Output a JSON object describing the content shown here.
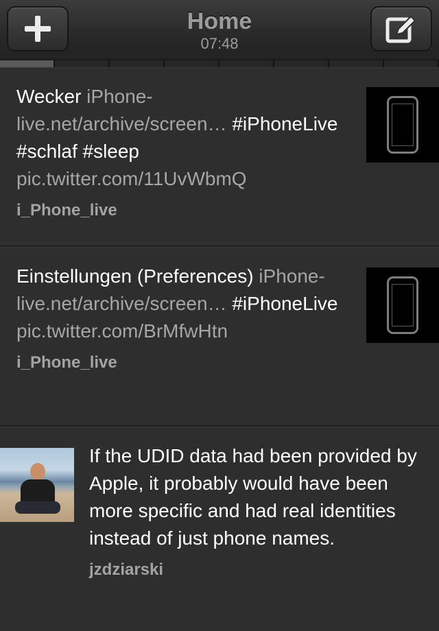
{
  "navbar": {
    "title": "Home",
    "time": "07:48",
    "left_button_icon": "plus-icon",
    "right_button_icon": "compose-icon"
  },
  "tabstrip": {
    "segments": 8,
    "active_index": 0
  },
  "tweets": [
    {
      "parts": [
        {
          "text": "Wecker ",
          "link": false
        },
        {
          "text": "iPhone-live.net/archive/screen…",
          "link": true
        },
        {
          "text": " #iPhoneLive #schlaf #sleep ",
          "link": false
        },
        {
          "text": "pic.twitter.com/11UvWbmQ",
          "link": true
        }
      ],
      "author": "i_Phone_live",
      "thumbnail": "phone-screenshot-thumbnail"
    },
    {
      "parts": [
        {
          "text": "Einstellungen (Preferences) ",
          "link": false
        },
        {
          "text": "iPhone-live.net/archive/screen…",
          "link": true
        },
        {
          "text": " #iPhoneLive ",
          "link": false
        },
        {
          "text": "pic.twitter.com/BrMfwHtn",
          "link": true
        }
      ],
      "author": "i_Phone_live",
      "thumbnail": "phone-screenshot-thumbnail"
    },
    {
      "parts": [
        {
          "text": "If the UDID data had been provided by Apple, it probably would have been more specific and had real identities instead of just phone names.",
          "link": false
        }
      ],
      "author": "jzdziarski",
      "avatar": "user-avatar"
    }
  ],
  "colors": {
    "background": "#2e2e2e",
    "link": "#a6a6a6",
    "author": "#a3a3a3",
    "title": "#9c9c9c"
  }
}
